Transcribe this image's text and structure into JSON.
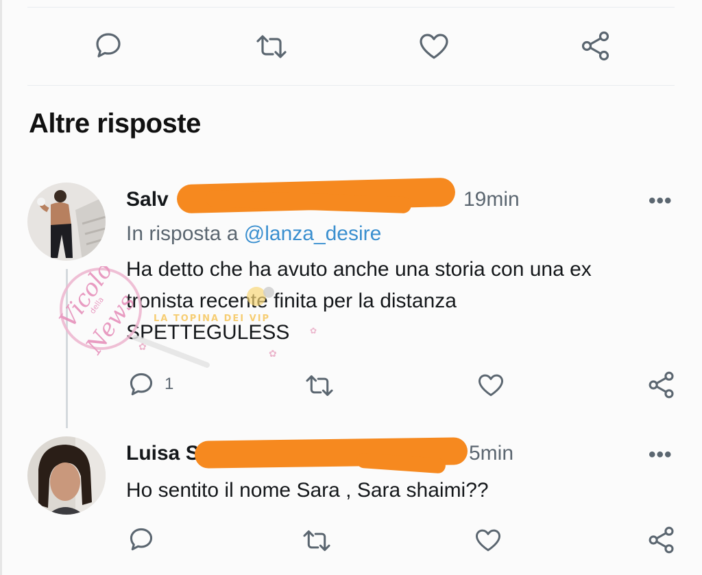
{
  "section_title": "Altre risposte",
  "top_actions": [
    "reply-icon",
    "retweet-icon",
    "like-icon",
    "share-icon"
  ],
  "replies": [
    {
      "name_visible": "Salv",
      "time": "19min",
      "reply_prefix": "In risposta a ",
      "reply_handle": "@lanza_desire",
      "lines": [
        "Ha detto che ha avuto anche una storia con una ex",
        "tronista recente finita per la distanza",
        "SPETTEGULESS"
      ],
      "reply_count": "1",
      "more": "•••"
    },
    {
      "name_visible": "Luisa S",
      "time": "5min",
      "lines": [
        "Ho sentito il nome Sara , Sara shaimi??"
      ],
      "more": "•••"
    }
  ],
  "watermark": {
    "brand": "Vicolo",
    "mid": "della",
    "end": "News",
    "tagline": "LA TOPINA DEI VIP",
    "color": "#e58bb8"
  },
  "colors": {
    "redaction": "#f6891f",
    "icon": "#5b6670",
    "mention": "#3a8fcf"
  }
}
